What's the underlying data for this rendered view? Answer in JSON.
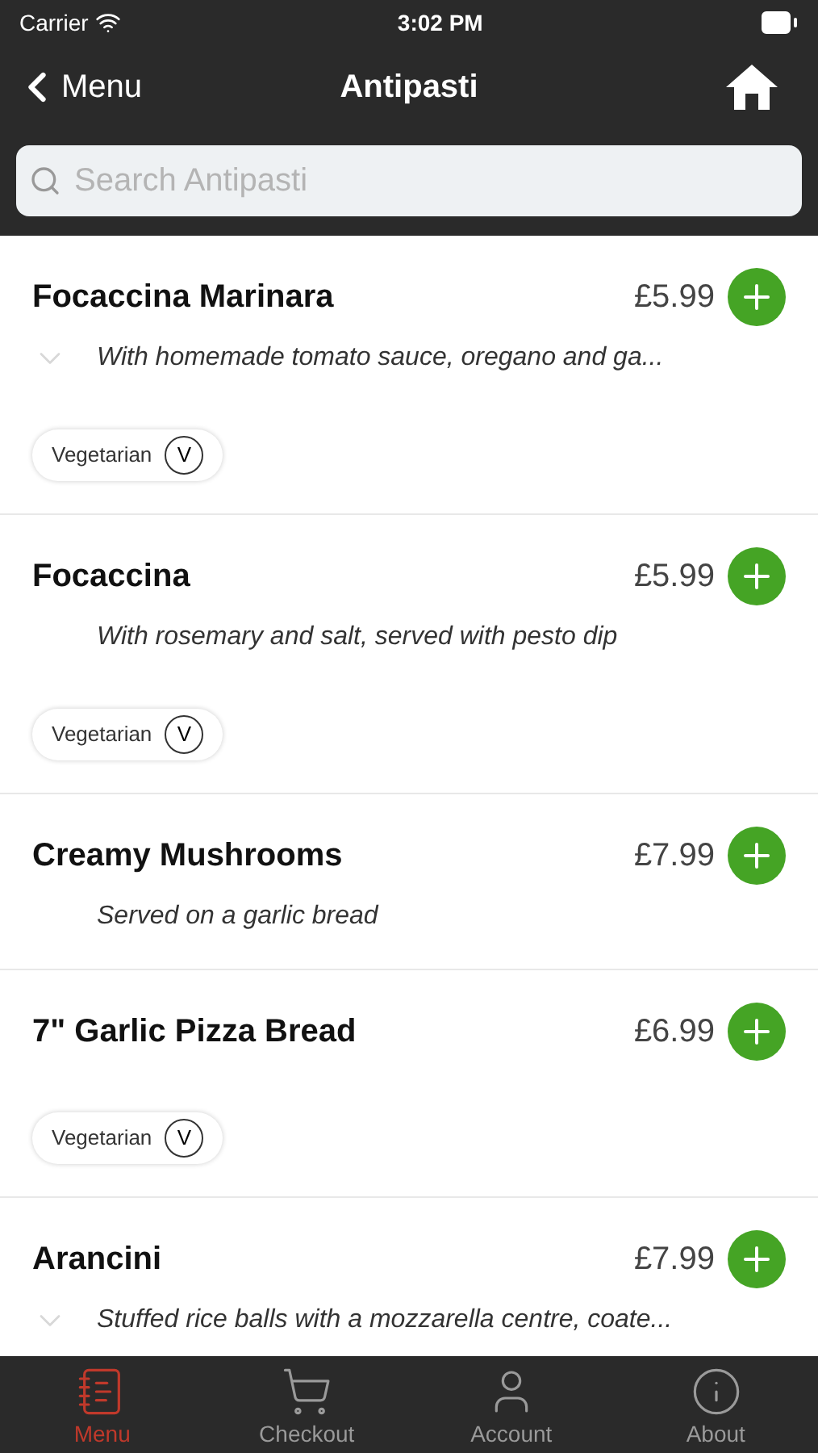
{
  "status_bar": {
    "carrier": "Carrier",
    "time": "3:02 PM"
  },
  "nav": {
    "back_label": "Menu",
    "title": "Antipasti"
  },
  "search": {
    "placeholder": "Search Antipasti"
  },
  "items": [
    {
      "name": "Focaccina Marinara",
      "price": "£5.99",
      "expandable": true,
      "description": "With homemade tomato sauce, oregano and ga...",
      "tags": [
        {
          "label": "Vegetarian",
          "symbol": "V"
        }
      ]
    },
    {
      "name": "Focaccina",
      "price": "£5.99",
      "expandable": false,
      "description": "With rosemary and salt, served with pesto dip",
      "tags": [
        {
          "label": "Vegetarian",
          "symbol": "V"
        }
      ]
    },
    {
      "name": "Creamy Mushrooms",
      "price": "£7.99",
      "expandable": false,
      "description": "Served on a garlic bread"
    },
    {
      "name": "7\" Garlic Pizza Bread",
      "price": "£6.99",
      "expandable": false,
      "tags": [
        {
          "label": "Vegetarian",
          "symbol": "V"
        }
      ]
    },
    {
      "name": "Arancini",
      "price": "£7.99",
      "expandable": true,
      "description": "Stuffed rice balls with a mozzarella centre, coate..."
    }
  ],
  "tab_bar": [
    {
      "label": "Menu",
      "selected": true
    },
    {
      "label": "Checkout",
      "selected": false
    },
    {
      "label": "Account",
      "selected": false
    },
    {
      "label": "About",
      "selected": false
    }
  ]
}
